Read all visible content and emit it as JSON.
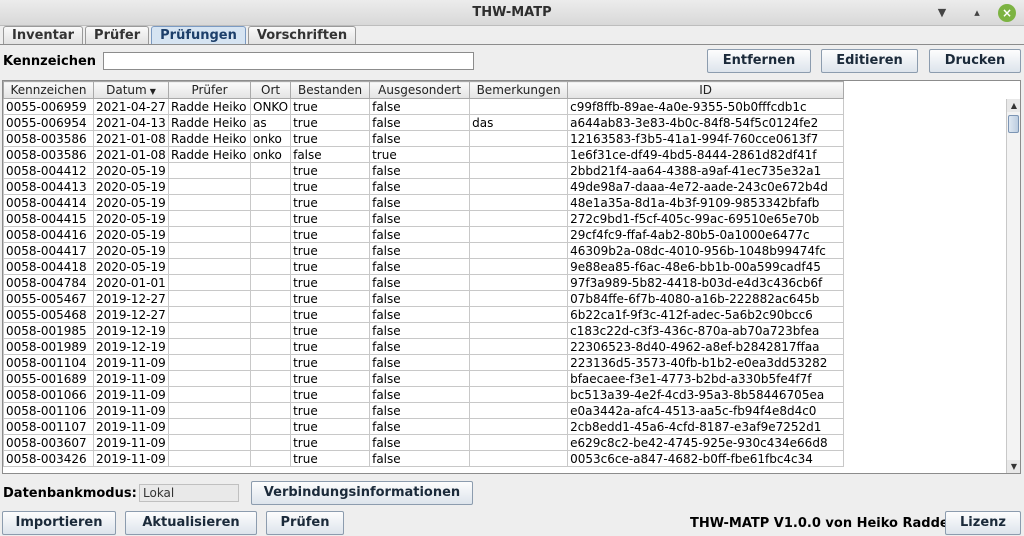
{
  "window": {
    "title": "THW-MATP"
  },
  "tabs": [
    {
      "label": "Inventar",
      "active": false
    },
    {
      "label": "Prüfer",
      "active": false
    },
    {
      "label": "Prüfungen",
      "active": true
    },
    {
      "label": "Vorschriften",
      "active": false
    }
  ],
  "search": {
    "label": "Kennzeichen",
    "value": ""
  },
  "toolbar": {
    "remove": "Entfernen",
    "edit": "Editieren",
    "print": "Drucken"
  },
  "table": {
    "columns": [
      "Kennzeichen",
      "Datum",
      "Prüfer",
      "Ort",
      "Bestanden",
      "Ausgesondert",
      "Bemerkungen",
      "ID"
    ],
    "sorted_column": "Datum",
    "rows": [
      [
        "0055-006959",
        "2021-04-27",
        "Radde Heiko",
        "ONKO",
        "true",
        "false",
        "",
        "c99f8ffb-89ae-4a0e-9355-50b0fffcdb1c"
      ],
      [
        "0055-006954",
        "2021-04-13",
        "Radde Heiko",
        "as",
        "true",
        "false",
        "das",
        "a644ab83-3e83-4b0c-84f8-54f5c0124fe2"
      ],
      [
        "0058-003586",
        "2021-01-08",
        "Radde Heiko",
        "onko",
        "true",
        "false",
        "",
        "12163583-f3b5-41a1-994f-760cce0613f7"
      ],
      [
        "0058-003586",
        "2021-01-08",
        "Radde Heiko",
        "onko",
        "false",
        "true",
        "",
        "1e6f31ce-df49-4bd5-8444-2861d82df41f"
      ],
      [
        "0058-004412",
        "2020-05-19",
        "",
        "",
        "true",
        "false",
        "",
        "2bbd21f4-aa64-4388-a9af-41ec735e32a1"
      ],
      [
        "0058-004413",
        "2020-05-19",
        "",
        "",
        "true",
        "false",
        "",
        "49de98a7-daaa-4e72-aade-243c0e672b4d"
      ],
      [
        "0058-004414",
        "2020-05-19",
        "",
        "",
        "true",
        "false",
        "",
        "48e1a35a-8d1a-4b3f-9109-9853342bfafb"
      ],
      [
        "0058-004415",
        "2020-05-19",
        "",
        "",
        "true",
        "false",
        "",
        "272c9bd1-f5cf-405c-99ac-69510e65e70b"
      ],
      [
        "0058-004416",
        "2020-05-19",
        "",
        "",
        "true",
        "false",
        "",
        "29cf4fc9-ffaf-4ab2-80b5-0a1000e6477c"
      ],
      [
        "0058-004417",
        "2020-05-19",
        "",
        "",
        "true",
        "false",
        "",
        "46309b2a-08dc-4010-956b-1048b99474fc"
      ],
      [
        "0058-004418",
        "2020-05-19",
        "",
        "",
        "true",
        "false",
        "",
        "9e88ea85-f6ac-48e6-bb1b-00a599cadf45"
      ],
      [
        "0058-004784",
        "2020-01-01",
        "",
        "",
        "true",
        "false",
        "",
        "97f3a989-5b82-4418-b03d-e4d3c436cb6f"
      ],
      [
        "0055-005467",
        "2019-12-27",
        "",
        "",
        "true",
        "false",
        "",
        "07b84ffe-6f7b-4080-a16b-222882ac645b"
      ],
      [
        "0055-005468",
        "2019-12-27",
        "",
        "",
        "true",
        "false",
        "",
        "6b22ca1f-9f3c-412f-adec-5a6b2c90bcc6"
      ],
      [
        "0058-001985",
        "2019-12-19",
        "",
        "",
        "true",
        "false",
        "",
        "c183c22d-c3f3-436c-870a-ab70a723bfea"
      ],
      [
        "0058-001989",
        "2019-12-19",
        "",
        "",
        "true",
        "false",
        "",
        "22306523-8d40-4962-a8ef-b2842817ffaa"
      ],
      [
        "0058-001104",
        "2019-11-09",
        "",
        "",
        "true",
        "false",
        "",
        "223136d5-3573-40fb-b1b2-e0ea3dd53282"
      ],
      [
        "0055-001689",
        "2019-11-09",
        "",
        "",
        "true",
        "false",
        "",
        "bfaecaee-f3e1-4773-b2bd-a330b5fe4f7f"
      ],
      [
        "0058-001066",
        "2019-11-09",
        "",
        "",
        "true",
        "false",
        "",
        "bc513a39-4e2f-4cd3-95a3-8b58446705ea"
      ],
      [
        "0058-001106",
        "2019-11-09",
        "",
        "",
        "true",
        "false",
        "",
        "e0a3442a-afc4-4513-aa5c-fb94f4e8d4c0"
      ],
      [
        "0058-001107",
        "2019-11-09",
        "",
        "",
        "true",
        "false",
        "",
        "2cb8edd1-45a6-4cfd-8187-e3af9e7252d1"
      ],
      [
        "0058-003607",
        "2019-11-09",
        "",
        "",
        "true",
        "false",
        "",
        "e629c8c2-be42-4745-925e-930c434e66d8"
      ],
      [
        "0058-003426",
        "2019-11-09",
        "",
        "",
        "true",
        "false",
        "",
        "0053c6ce-a847-4682-b0ff-fbe61fbc4c34"
      ]
    ]
  },
  "footer": {
    "mode_label": "Datenbankmodus:",
    "mode_value": "Lokal",
    "connection_info": "Verbindungsinformationen",
    "import": "Importieren",
    "refresh": "Aktualisieren",
    "check": "Prüfen",
    "version": "THW-MATP V1.0.0 von Heiko Radde",
    "license": "Lizenz"
  },
  "colors": {
    "accent": "#7b9ac2",
    "close_button": "#7cb342"
  }
}
